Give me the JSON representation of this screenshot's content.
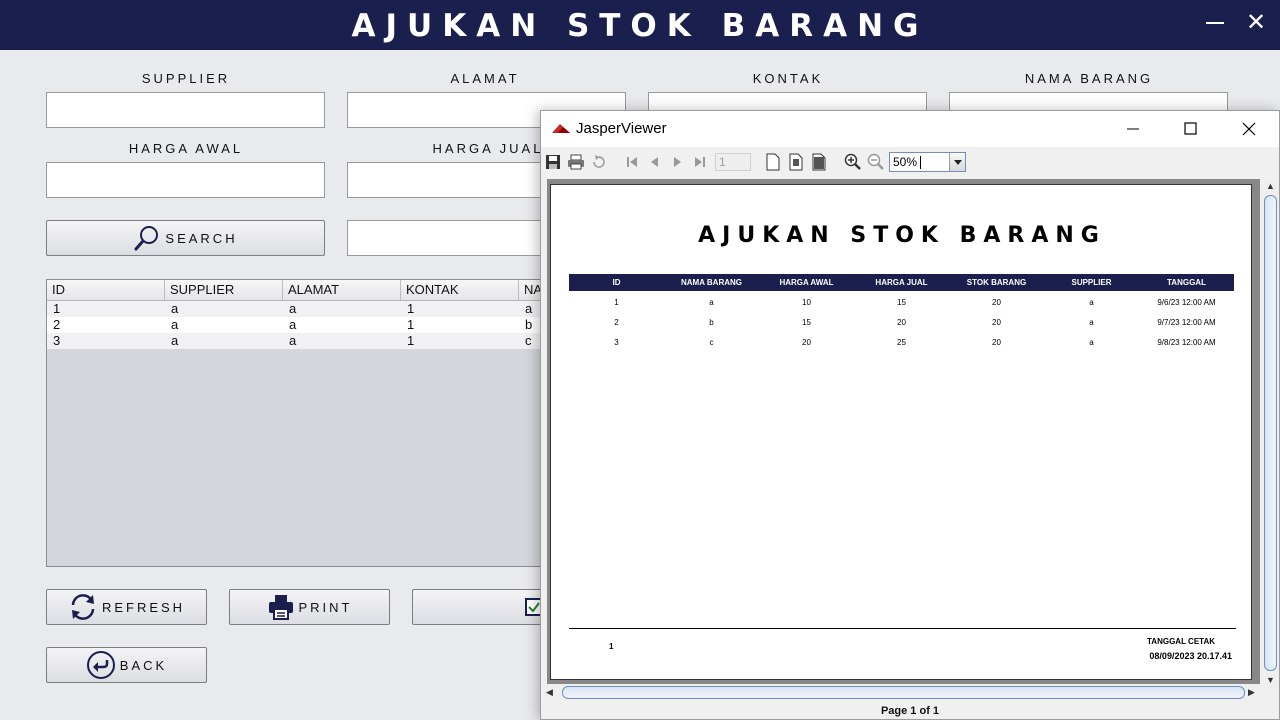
{
  "app": {
    "title": "AJUKAN STOK BARANG",
    "minimize_glyph": "—",
    "close_glyph": "✕"
  },
  "form": {
    "labels": {
      "supplier": "SUPPLIER",
      "alamat": "ALAMAT",
      "kontak": "KONTAK",
      "nama_barang": "NAMA BARANG",
      "harga_awal": "HARGA AWAL",
      "harga_jual": "HARGA JUAL"
    },
    "values": {
      "supplier": "",
      "alamat": "",
      "kontak": "",
      "nama_barang": "",
      "harga_awal": "",
      "harga_jual": "",
      "search_text": ""
    }
  },
  "buttons": {
    "search": "SEARCH",
    "refresh": "REFRESH",
    "print": "PRINT",
    "back": "BACK"
  },
  "table": {
    "columns": [
      "ID",
      "SUPPLIER",
      "ALAMAT",
      "KONTAK",
      "NA"
    ],
    "rows": [
      [
        "1",
        "a",
        "a",
        "1",
        "a"
      ],
      [
        "2",
        "a",
        "a",
        "1",
        "b"
      ],
      [
        "3",
        "a",
        "a",
        "1",
        "c"
      ]
    ]
  },
  "viewer": {
    "window_title": "JasperViewer",
    "page_number": "1",
    "zoom": "50%",
    "status": "Page 1 of 1",
    "icons": [
      "save-icon",
      "print-icon",
      "reload-icon",
      "first-page-icon",
      "previous-page-icon",
      "next-page-icon",
      "last-page-icon",
      "actual-size-icon",
      "fit-page-icon",
      "fit-width-icon",
      "zoom-in-icon",
      "zoom-out-icon"
    ]
  },
  "report": {
    "title": "AJUKAN STOK BARANG",
    "columns": [
      "ID",
      "NAMA BARANG",
      "HARGA AWAL",
      "HARGA JUAL",
      "STOK BARANG",
      "SUPPLIER",
      "TANGGAL"
    ],
    "rows": [
      [
        "1",
        "a",
        "10",
        "15",
        "20",
        "a",
        "9/6/23 12:00 AM"
      ],
      [
        "2",
        "b",
        "15",
        "20",
        "20",
        "a",
        "9/7/23 12:00 AM"
      ],
      [
        "3",
        "c",
        "20",
        "25",
        "20",
        "a",
        "9/8/23 12:00 AM"
      ]
    ],
    "page_number": "1",
    "print_label": "TANGGAL CETAK",
    "print_date": "08/09/2023 20.17.41"
  },
  "colors": {
    "header_navy": "#1b1f4e",
    "background": "#e9eaee"
  }
}
